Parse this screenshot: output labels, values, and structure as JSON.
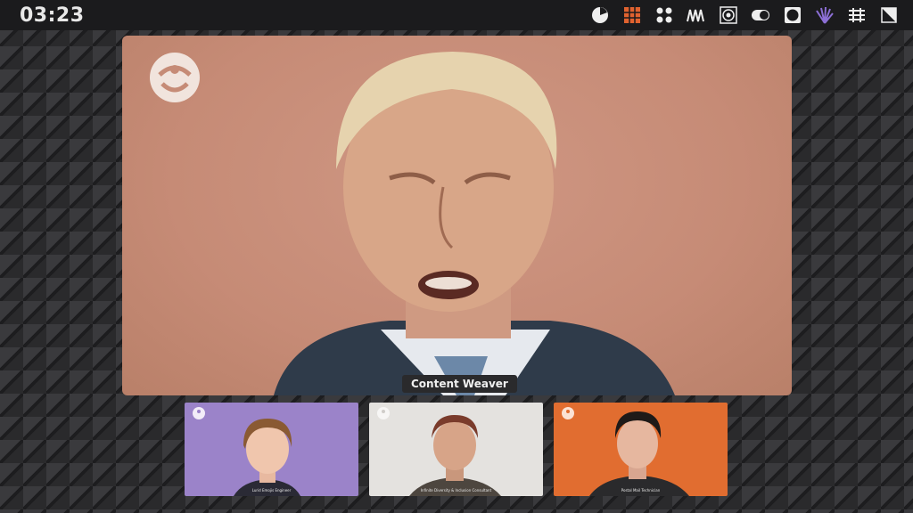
{
  "status_bar": {
    "time": "03:23",
    "icons": [
      "pie-icon",
      "grid-pattern-icon",
      "dots-icon",
      "wave-icon",
      "spiral-icon",
      "toggle-icon",
      "square-icon",
      "fan-icon",
      "lattice-icon",
      "slash-square-icon"
    ]
  },
  "main_video": {
    "name_label": "Content Weaver",
    "background_color": "#c68b76"
  },
  "participants": [
    {
      "caption": "Lurid Emojis Engineer",
      "background_color": "#9b83c9"
    },
    {
      "caption": "Infinite Diversity & Inclusion Consultant",
      "background_color": "#e4e2df"
    },
    {
      "caption": "Postal Mail Technician",
      "background_color": "#e16d30"
    }
  ]
}
